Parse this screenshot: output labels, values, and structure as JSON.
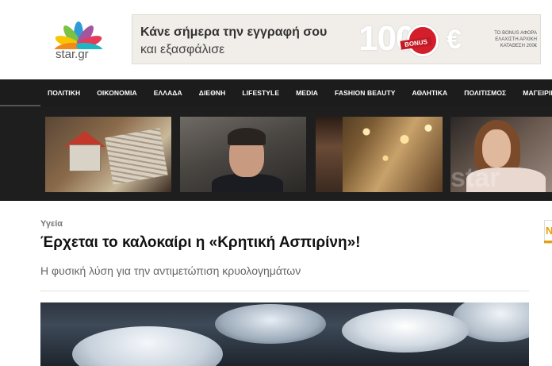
{
  "header": {
    "logo_text": "star.gr",
    "banner": {
      "line1": "Κάνε σήμερα την εγγραφή σου",
      "line2": "και εξασφάλισε",
      "amount": "100",
      "badge": "BONUS",
      "currency": "€",
      "note": "ΤΟ BONUS ΑΦΟΡΑ ΕΛΑΧΙΣΤΗ ΑΡΧΙΚΗ ΚΑΤΑΘΕΣΗ 200€"
    }
  },
  "nav": {
    "items": [
      "ΠΟΛΙΤΙΚΗ",
      "ΟΙΚΟΝΟΜΙΑ",
      "ΕΛΛΑΔΑ",
      "ΔΙΕΘΝΗ",
      "LIFESTYLE",
      "MEDIA",
      "FASHION BEAUTY",
      "ΑΘΛΗΤΙΚΑ",
      "ΠΟΛΙΤΙΣΜΟΣ",
      "ΜΑΓΕΙΡΙΚΗ"
    ]
  },
  "strip": {
    "watermark": "star"
  },
  "article": {
    "category": "Υγεία",
    "title": "Έρχεται το καλοκαίρι η «Κρητική Ασπιρίνη»!",
    "subtitle": "Η φυσική λύση για την αντιμετώπιση κρυολογημάτων"
  },
  "sidebar": {
    "letter": "Ν"
  },
  "colors": {
    "nav_bg": "#1c1c1c",
    "strip_bg": "#1e1e1e",
    "accent": "#e8a000",
    "badge_red": "#d31f2b"
  }
}
